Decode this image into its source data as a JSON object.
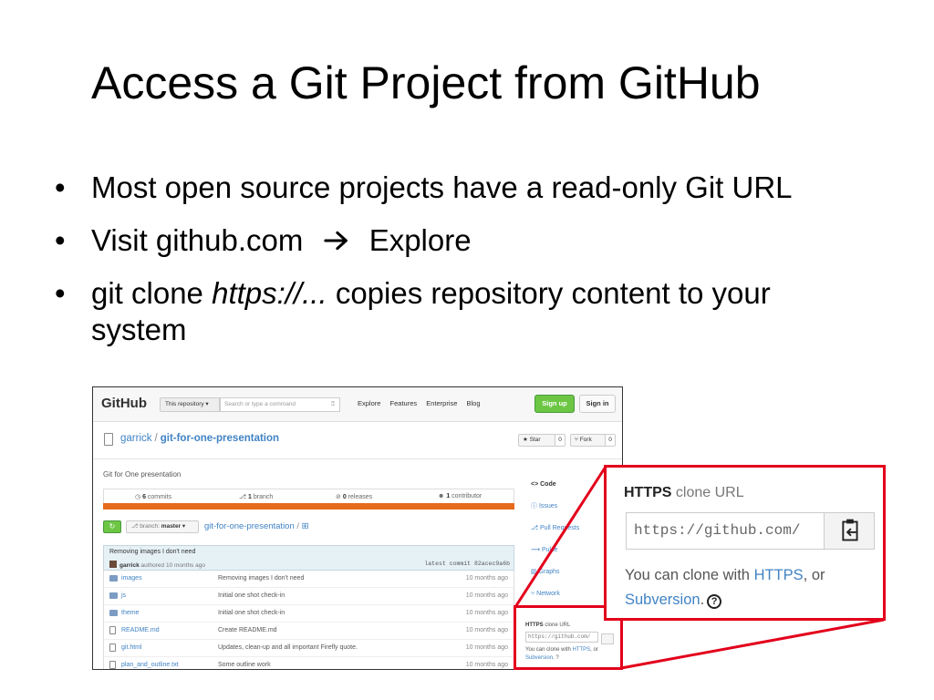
{
  "slide": {
    "title": "Access a Git Project from GitHub",
    "bullets": {
      "b1": "Most open source projects have a read-only Git URL",
      "b2_before": "Visit github.com",
      "b2_after": "Explore",
      "b3_before": "git clone ",
      "b3_italic": "https://...",
      "b3_after": " copies repository content to your",
      "b3_wrap": "system"
    },
    "bullet_glyph": "•",
    "arrow_icon": "right-arrow-icon"
  },
  "github": {
    "logo": "GitHub",
    "scope": "This repository ▾",
    "search_placeholder": "Search or type a command",
    "search_icon_glyph": "⍰",
    "nav": [
      "Explore",
      "Features",
      "Enterprise",
      "Blog"
    ],
    "signup": "Sign up",
    "signin": "Sign in",
    "repo_owner": "garrick",
    "repo_sep": "/",
    "repo_name": "git-for-one-presentation",
    "star_label": "★ Star",
    "star_count": "0",
    "fork_label": "⑂ Fork",
    "fork_count": "0",
    "description": "Git for One presentation",
    "stats": {
      "commits_n": "6",
      "commits": " commits",
      "branch_n": "1",
      "branch": " branch",
      "releases_n": "0",
      "releases": " releases",
      "contrib_n": "1",
      "contrib": " contributor"
    },
    "lang_color": "#e66a1c",
    "sync_glyph": "↻",
    "branch_prefix": "branch: ",
    "branch_name": "master ▾",
    "path_repo": "git-for-one-presentation",
    "path_slash": " / ",
    "path_plus": "⊞",
    "commit_message": "Removing images I don't need",
    "commit_author": "garrick",
    "commit_when": " authored 10 months ago",
    "commit_latest": "latest commit 82acec9a6b",
    "files": [
      {
        "name": "images",
        "msg": "Removing images I don't need",
        "age": "10 months ago",
        "icon": "folder-icon"
      },
      {
        "name": "js",
        "msg": "Initial one shot check-in",
        "age": "10 months ago",
        "icon": "folder-icon"
      },
      {
        "name": "theme",
        "msg": "Initial one shot check-in",
        "age": "10 months ago",
        "icon": "folder-icon"
      },
      {
        "name": "README.md",
        "msg": "Create README.md",
        "age": "10 months ago",
        "icon": "file-icon"
      },
      {
        "name": "git.html",
        "msg": "Updates, clean-up and all important Firefly quote.",
        "age": "10 months ago",
        "icon": "file-icon"
      },
      {
        "name": "plan_and_outline.txt",
        "msg": "Some outline work",
        "age": "10 months ago",
        "icon": "file-icon"
      }
    ],
    "sidebar": [
      "<> Code",
      "ⓘ Issues",
      "⎇ Pull Requests",
      "⟿ Pulse",
      "▥ Graphs",
      "⑂ Network"
    ],
    "mini_clone": {
      "label_bold": "HTTPS",
      "label": " clone URL",
      "url": "https://github.com/",
      "help_before": "You can clone with ",
      "help_https": "HTTPS",
      "help_mid": ", or",
      "help_svn": "Subversion",
      "help_end": ". ?"
    }
  },
  "callout": {
    "label_bold": "HTTPS",
    "label": " clone URL",
    "url": "https://github.com/",
    "help_before": "You can clone with ",
    "help_https": "HTTPS",
    "help_mid": ", or",
    "help_svn": "Subversion",
    "help_end": ".",
    "help_icon": "?",
    "border_color": "#e3001b"
  }
}
